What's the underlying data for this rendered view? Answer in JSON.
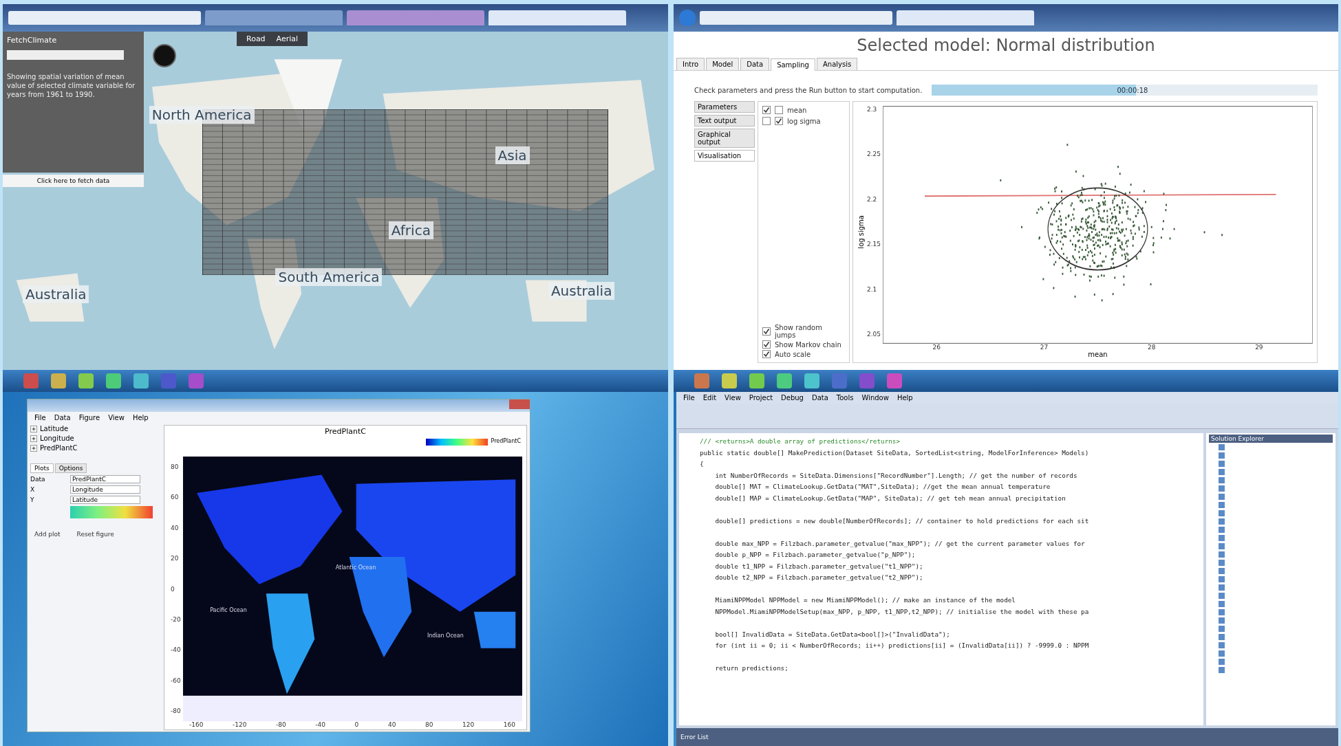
{
  "map_app": {
    "panel_title": "FetchClimate",
    "description": "Showing spatial variation of mean value of selected climate variable for years from 1961 to 1990.",
    "fetch_link": "Click here to fetch data",
    "toolbar": [
      "Road",
      "Aerial"
    ],
    "labels": [
      "North America",
      "Asia",
      "Africa",
      "South America",
      "Australia",
      "Australia"
    ]
  },
  "sampling_app": {
    "title": "Selected model: Normal distribution",
    "tabs": [
      {
        "label": "Intro",
        "selected": false
      },
      {
        "label": "Model",
        "selected": false
      },
      {
        "label": "Data",
        "selected": false
      },
      {
        "label": "Sampling",
        "selected": true
      },
      {
        "label": "Analysis",
        "selected": false
      }
    ],
    "instruction": "Check parameters and press the Run button to start computation.",
    "progress": {
      "level": 0.53,
      "reading": "00:00:18"
    },
    "side_buttons": [
      {
        "label": "Parameters",
        "selected": false
      },
      {
        "label": "Text output",
        "selected": false
      },
      {
        "label": "Graphical output",
        "selected": false
      },
      {
        "label": "Visualisation",
        "selected": true
      }
    ],
    "parameters": [
      {
        "name": "mean",
        "x_checked": true,
        "y_checked": false
      },
      {
        "name": "log sigma",
        "x_checked": false,
        "y_checked": true
      }
    ],
    "options": [
      {
        "label": "Show random jumps",
        "checked": true
      },
      {
        "label": "Show Markov chain",
        "checked": true
      },
      {
        "label": "Auto scale",
        "checked": true
      }
    ],
    "plot": {
      "xlabel": "mean",
      "ylabel": "log sigma",
      "xticks": [
        "26",
        "27",
        "28",
        "29"
      ],
      "yticks": [
        "2.3",
        "2.25",
        "2.2",
        "2.15",
        "2.1",
        "2.05"
      ]
    }
  },
  "plot_app": {
    "menu": [
      "File",
      "Data",
      "Figure",
      "View",
      "Help"
    ],
    "tree": [
      {
        "label": "Latitude",
        "expanded": false
      },
      {
        "label": "Longitude",
        "expanded": false
      },
      {
        "label": "PredPlantC",
        "expanded": false
      }
    ],
    "tabs": [
      {
        "label": "Plots",
        "selected": true
      },
      {
        "label": "Options",
        "selected": false
      }
    ],
    "fields": [
      {
        "label": "Data",
        "value": "PredPlantC"
      },
      {
        "label": "X",
        "value": "Longitude"
      },
      {
        "label": "Y",
        "value": "Latitude"
      }
    ],
    "buttons": [
      "Add plot",
      "Reset figure"
    ],
    "figure_title": "PredPlantC",
    "legend_label": "PredPlantC",
    "oceans": [
      "Pacific Ocean",
      "Atlantic Ocean",
      "Indian Ocean"
    ],
    "xticks": [
      "-160",
      "-120",
      "-80",
      "-40",
      "0",
      "40",
      "80",
      "120",
      "160"
    ],
    "yticks": [
      "80",
      "60",
      "40",
      "20",
      "0",
      "-20",
      "-40",
      "-60",
      "-80"
    ]
  },
  "ide": {
    "menu": [
      "File",
      "Edit",
      "View",
      "Project",
      "Debug",
      "Data",
      "Tools",
      "Window",
      "Help"
    ],
    "panel_title": "Solution Explorer",
    "error_panel": "Error List",
    "code": [
      {
        "text": "/// <returns>A double array of predictions</returns>",
        "kind": "comment"
      },
      {
        "text": "public static double[] MakePrediction(Dataset SiteData, SortedList<string, ModelForInference> Models)",
        "kind": "code"
      },
      {
        "text": "{",
        "kind": "code"
      },
      {
        "text": "    int NumberOfRecords = SiteData.Dimensions[\"RecordNumber\"].Length; // get the number of records",
        "kind": "code"
      },
      {
        "text": "    double[] MAT = ClimateLookup.GetData(\"MAT\",SiteData); //get the mean annual temperature",
        "kind": "code"
      },
      {
        "text": "    double[] MAP = ClimateLookup.GetData(\"MAP\", SiteData); // get teh mean annual precipitation",
        "kind": "code"
      },
      {
        "kind": "blank"
      },
      {
        "text": "    double[] predictions = new double[NumberOfRecords]; // container to hold predictions for each sit",
        "kind": "code"
      },
      {
        "kind": "blank"
      },
      {
        "text": "    double max_NPP = Filzbach.parameter_getvalue(\"max_NPP\"); // get the current parameter values for",
        "kind": "code"
      },
      {
        "text": "    double p_NPP = Filzbach.parameter_getvalue(\"p_NPP\");",
        "kind": "code"
      },
      {
        "text": "    double t1_NPP = Filzbach.parameter_getvalue(\"t1_NPP\");",
        "kind": "code"
      },
      {
        "text": "    double t2_NPP = Filzbach.parameter_getvalue(\"t2_NPP\");",
        "kind": "code"
      },
      {
        "kind": "blank"
      },
      {
        "text": "    MiamiNPPModel NPPModel = new MiamiNPPModel(); // make an instance of the model",
        "kind": "code"
      },
      {
        "text": "    NPPModel.MiamiNPPModelSetup(max_NPP, p_NPP, t1_NPP,t2_NPP); // initialise the model with these pa",
        "kind": "code"
      },
      {
        "kind": "blank"
      },
      {
        "text": "    bool[] InvalidData = SiteData.GetData<bool[]>(\"InvalidData\");",
        "kind": "code"
      },
      {
        "text": "    for (int ii = 0; ii < NumberOfRecords; ii++) predictions[ii] = (InvalidData[ii]) ? -9999.0 : NPPM",
        "kind": "code"
      },
      {
        "kind": "blank"
      },
      {
        "text": "    return predictions;",
        "kind": "code"
      }
    ]
  }
}
